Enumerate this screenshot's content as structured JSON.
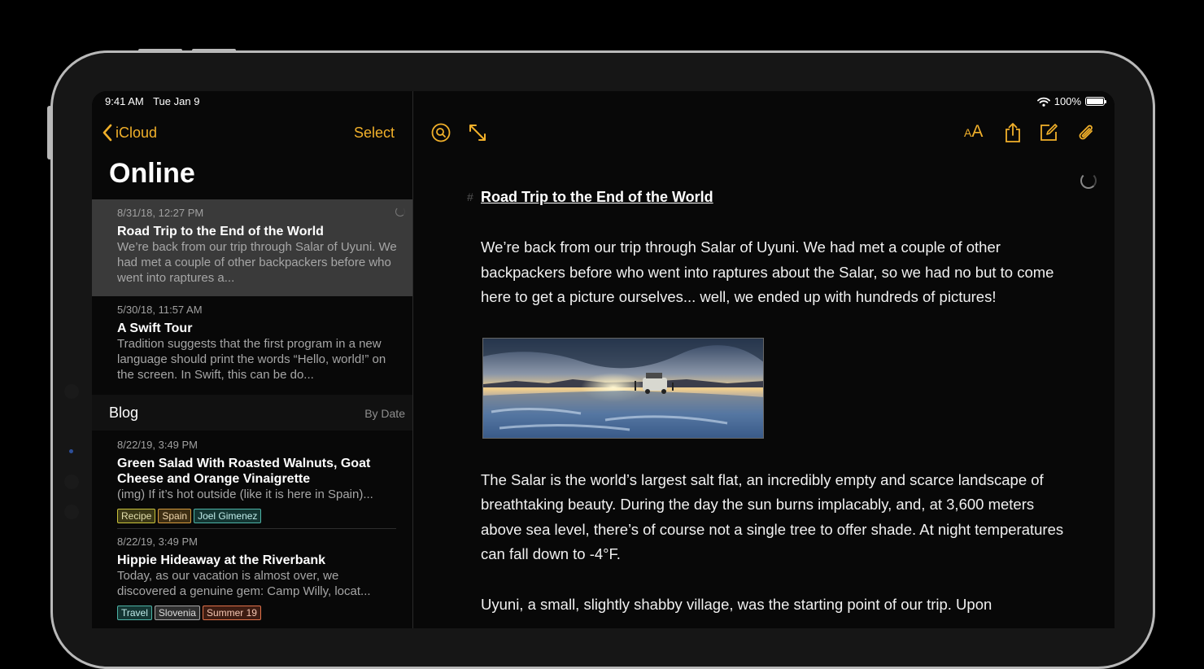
{
  "status": {
    "time": "9:41 AM",
    "date": "Tue Jan 9",
    "battery": "100%"
  },
  "sidebar": {
    "back_label": "iCloud",
    "select_label": "Select",
    "folder_title": "Online",
    "notes": [
      {
        "date": "8/31/18, 12:27 PM",
        "title": "Road Trip to the End of the World",
        "preview": "We’re back from our trip through Salar of Uyuni. We had met a couple of other backpackers before who went into raptures a..."
      },
      {
        "date": "5/30/18, 11:57 AM",
        "title": "A Swift Tour",
        "preview": "Tradition suggests that the first program in a new language should print the words “Hello, world!” on the screen. In Swift, this can be do..."
      }
    ],
    "section": {
      "title": "Blog",
      "sort_label": "By Date"
    },
    "blog_notes": [
      {
        "date": "8/22/19, 3:49 PM",
        "title": "Green Salad With Roasted Walnuts, Goat Cheese and Orange Vinaigrette",
        "preview": "(img) If it’s hot outside (like it is here in Spain)...",
        "tags": [
          {
            "label": "Recipe",
            "color": "#c9c23a"
          },
          {
            "label": "Spain",
            "color": "#d39a3d"
          },
          {
            "label": "Joel Gimenez",
            "color": "#4db3a6"
          }
        ]
      },
      {
        "date": "8/22/19, 3:49 PM",
        "title": "Hippie Hideaway at the Riverbank",
        "preview": "Today, as our vacation is almost over, we discovered a genuine gem: Camp Willy, locat...",
        "tags": [
          {
            "label": "Travel",
            "color": "#4db3a6"
          },
          {
            "label": "Slovenia",
            "color": "#a7a7a7"
          },
          {
            "label": "Summer 19",
            "color": "#e0714a"
          }
        ]
      }
    ]
  },
  "toolbar": {
    "icons": [
      "search-icon",
      "expand-icon",
      "text-size-icon",
      "share-icon",
      "compose-icon",
      "attachment-icon"
    ],
    "text_size_label_big": "A",
    "text_size_label_small": "A"
  },
  "document": {
    "heading_marker": "#",
    "title": "Road Trip to the End of the World",
    "paragraphs": [
      "We’re back from our trip through Salar of Uyuni. We had met a couple of other backpackers before who went into raptures about the Salar, so we had no but to come here to get a picture ourselves... well, we ended up with hundreds of pictures!",
      "The Salar is the world’s largest salt flat, an incredibly empty and scarce landscape of breathtaking beauty. During the day the sun burns implacably, and, at 3,600 meters above sea level, there’s of course not a single tree to offer shade. At night temperatures can fall down to -4°F.",
      "Uyuni, a small, slightly shabby village, was the starting point of our trip. Upon"
    ]
  },
  "colors": {
    "accent": "#f1b02a",
    "background": "#080808",
    "selected_row": "#3a3a3a"
  }
}
